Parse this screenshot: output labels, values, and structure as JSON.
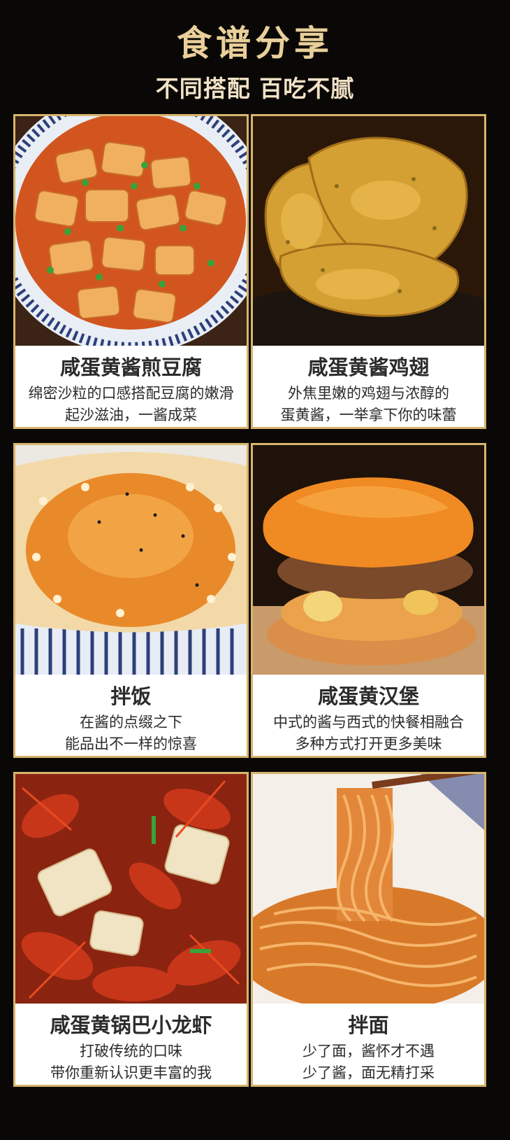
{
  "header": {
    "title": "食谱分享",
    "subtitle": "不同搭配 百吃不腻"
  },
  "recipes": [
    {
      "name": "咸蛋黄酱煎豆腐",
      "desc1": "绵密沙粒的口感搭配豆腐的嫩滑",
      "desc2": "起沙滋油，一酱成菜"
    },
    {
      "name": "咸蛋黄酱鸡翅",
      "desc1": "外焦里嫩的鸡翅与浓醇的",
      "desc2": "蛋黄酱，一举拿下你的味蕾"
    },
    {
      "name": "拌饭",
      "desc1": "在酱的点缀之下",
      "desc2": "能品出不一样的惊喜"
    },
    {
      "name": "咸蛋黄汉堡",
      "desc1": "中式的酱与西式的快餐相融合",
      "desc2": "多种方式打开更多美味"
    },
    {
      "name": "咸蛋黄锅巴小龙虾",
      "desc1": "打破传统的口味",
      "desc2": "带你重新认识更丰富的我"
    },
    {
      "name": "拌面",
      "desc1": "少了面，酱怀才不遇",
      "desc2": "少了酱，面无精打采"
    }
  ],
  "colors": {
    "background": "#0a0806",
    "gold": "#d8b46d",
    "title": "#e9cf9a",
    "text": "#2b2b2b"
  }
}
